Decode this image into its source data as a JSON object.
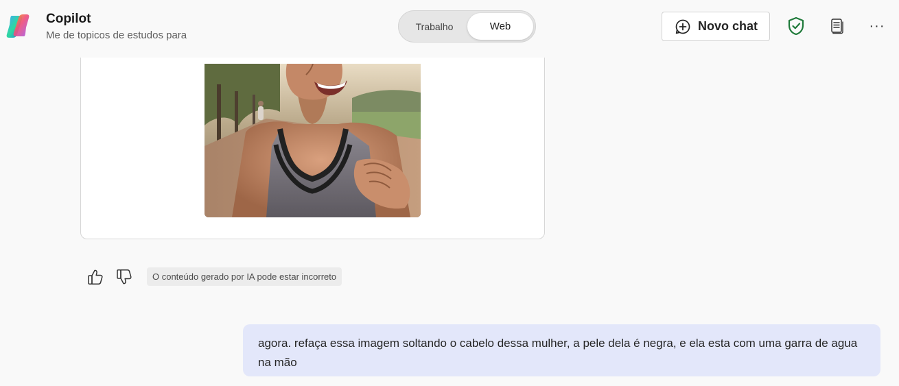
{
  "header": {
    "title": "Copilot",
    "subtitle": "Me de topicos de estudos para",
    "mode_options": [
      "Trabalho",
      "Web"
    ],
    "active_mode": "Web",
    "new_chat_label": "Novo chat",
    "icons": {
      "logo": "copilot-logo",
      "new_chat": "plus-chat-icon",
      "protection": "shield-check-icon",
      "notebook": "notebook-icon",
      "more": "more-horizontal-icon"
    },
    "colors": {
      "shield": "#1f7a3a"
    }
  },
  "response": {
    "image_alt": "generated-image-smiling-woman-running"
  },
  "feedback": {
    "like_icon": "thumbs-up-icon",
    "dislike_icon": "thumbs-down-icon",
    "disclaimer": "O conteúdo gerado por IA pode estar incorreto"
  },
  "user_message": {
    "text": "agora. refaça essa imagem soltando o cabelo dessa mulher, a pele dela é negra, e ela esta com uma garra de agua na mão",
    "background": "#e3e7fa"
  }
}
